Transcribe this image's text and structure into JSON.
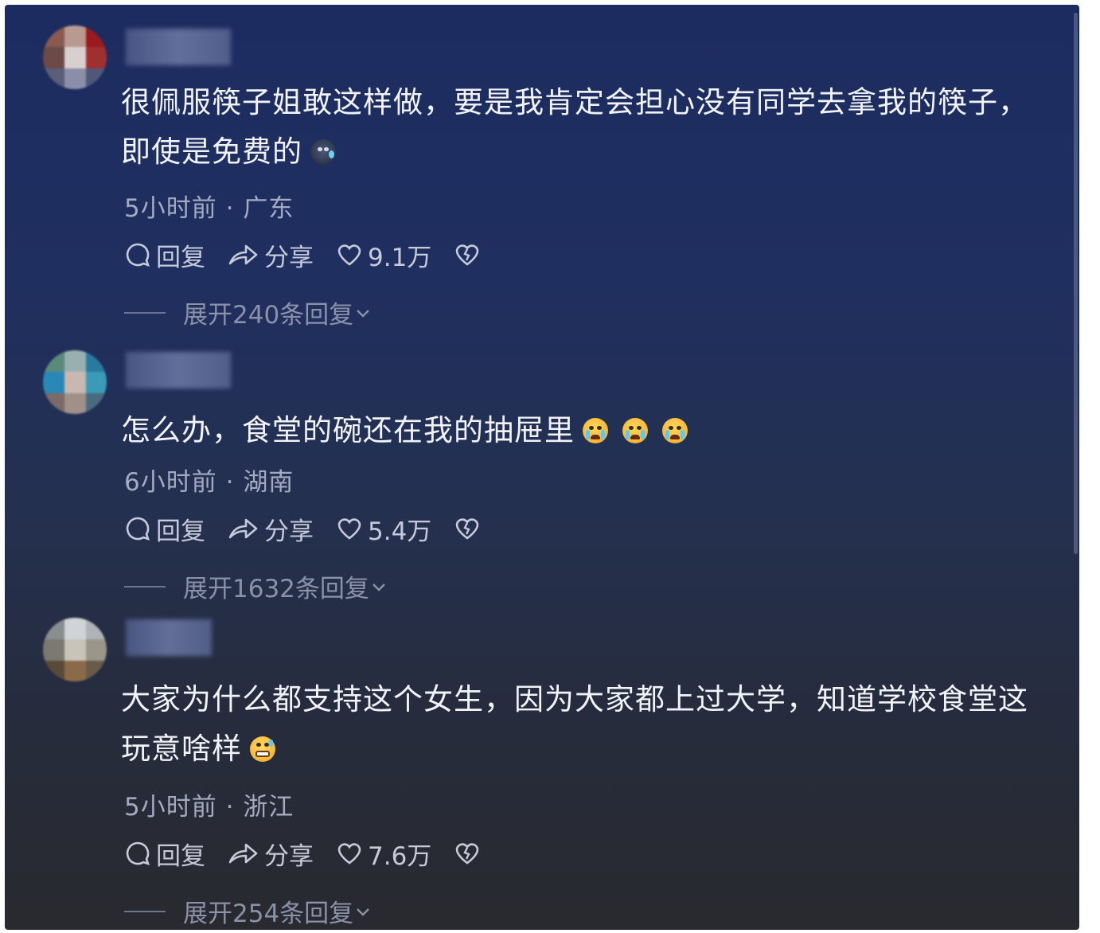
{
  "comments": [
    {
      "text": "很佩服筷子姐敢这样做，要是我肯定会担心没有同学去拿我的筷子，即使是免费的",
      "emoji": "dark-sweat-emoji",
      "time": "5小时前",
      "location": "广东",
      "reply_label": "回复",
      "share_label": "分享",
      "likes": "9.1万",
      "expand_label": "展开240条回复"
    },
    {
      "text": "怎么办，食堂的碗还在我的抽屉里",
      "emoji": "crying-emoji",
      "time": "6小时前",
      "location": "湖南",
      "reply_label": "回复",
      "share_label": "分享",
      "likes": "5.4万",
      "expand_label": "展开1632条回复"
    },
    {
      "text": "大家为什么都支持这个女生，因为大家都上过大学，知道学校食堂这玩意啥样",
      "emoji": "grin-sweat-emoji",
      "time": "5小时前",
      "location": "浙江",
      "reply_label": "回复",
      "share_label": "分享",
      "likes": "7.6万",
      "expand_label": "展开254条回复"
    }
  ],
  "separator": "·",
  "colors": {
    "background_top": "#1d2c60",
    "background_bottom": "#292a2f",
    "text": "#f2f3f7",
    "meta": "#a4aac0"
  }
}
